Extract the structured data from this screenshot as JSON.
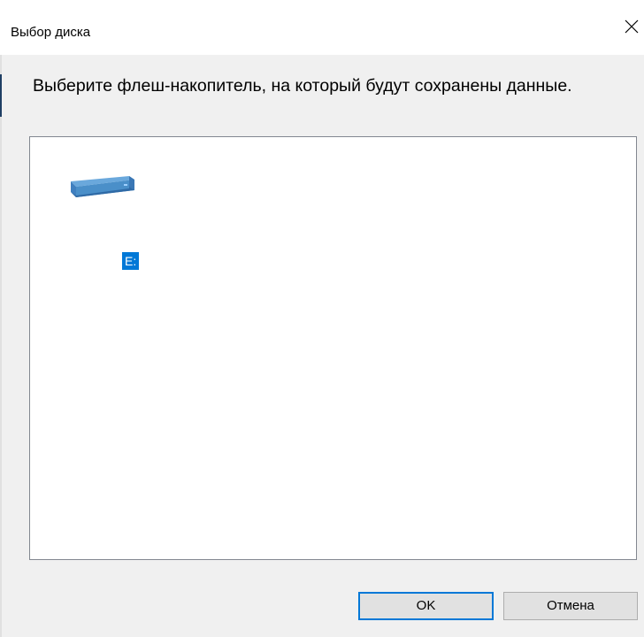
{
  "window": {
    "title": "Выбор диска",
    "close_glyph": "✕"
  },
  "prompt": {
    "text": "Выберите флеш-накопитель, на который будут сохранены данные."
  },
  "drives": [
    {
      "label": "E:",
      "icon": "drive-icon",
      "selected": true
    }
  ],
  "buttons": {
    "ok_label": "OK",
    "cancel_label": "Отмена"
  },
  "colors": {
    "selection": "#0078d7",
    "drive_icon": "#4a8fc9"
  }
}
